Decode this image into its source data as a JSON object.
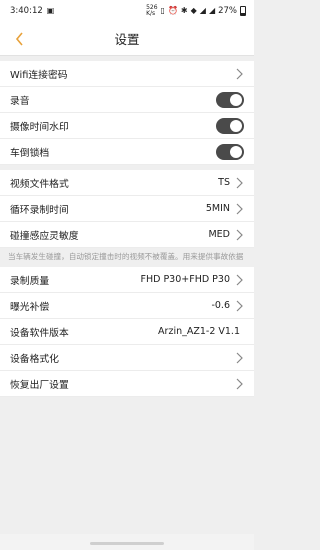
{
  "status_bar": {
    "time": "3:40:12",
    "speed": "526\nK/s",
    "battery": "27%"
  },
  "header": {
    "title": "设置"
  },
  "rows": {
    "wifi": {
      "label": "Wifi连接密码"
    },
    "audio": {
      "label": "录音",
      "on": true
    },
    "watermark": {
      "label": "摄像时间水印",
      "on": true
    },
    "reverse_lock": {
      "label": "车倒锁档",
      "on": true
    },
    "video_format": {
      "label": "视频文件格式",
      "value": "TS"
    },
    "loop_time": {
      "label": "循环录制时间",
      "value": "5MIN"
    },
    "collision": {
      "label": "碰撞感应灵敏度",
      "value": "MED"
    },
    "quality": {
      "label": "录制质量",
      "value": "FHD P30+FHD P30"
    },
    "exposure": {
      "label": "曝光补偿",
      "value": "-0.6"
    },
    "firmware": {
      "label": "设备软件版本",
      "value": "Arzin_AZ1-2 V1.1"
    },
    "format": {
      "label": "设备格式化"
    },
    "reset": {
      "label": "恢复出厂设置"
    }
  },
  "collision_note": "当车辆发生碰撞，自动锁定撞击时的视频不被覆盖。用来提供事故依据",
  "colors": {
    "accent": "#e8a13a",
    "toggle_on": "#4a4a4a"
  },
  "icons": [
    "back-icon",
    "chevron-right-icon"
  ]
}
